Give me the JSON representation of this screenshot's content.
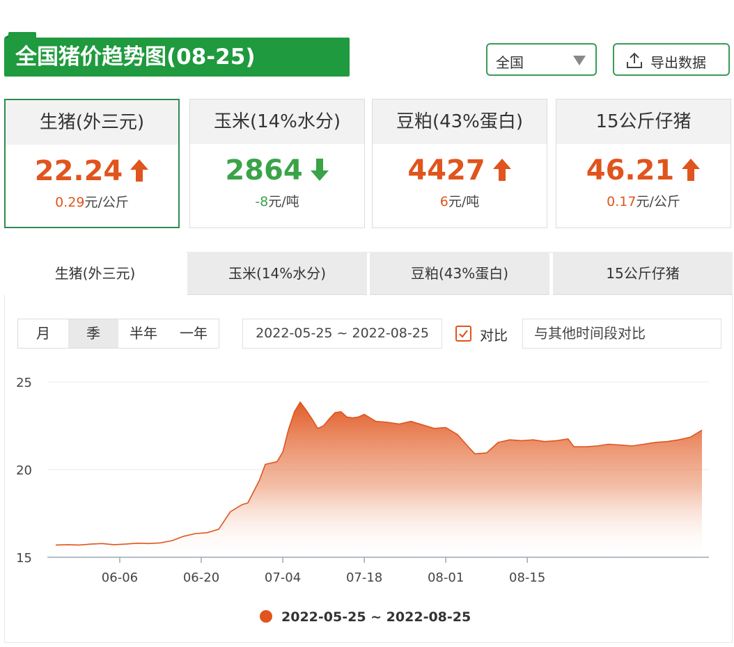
{
  "header": {
    "title": "全国猪价趋势图(08-25)",
    "region_select": "全国",
    "export_label": "导出数据"
  },
  "cards": [
    {
      "name": "生猪(外三元)",
      "value": "22.24",
      "direction": "up",
      "change": "0.29",
      "unit": "元/公斤"
    },
    {
      "name": "玉米(14%水分)",
      "value": "2864",
      "direction": "down",
      "change": "-8",
      "unit": "元/吨"
    },
    {
      "name": "豆粕(43%蛋白)",
      "value": "4427",
      "direction": "up",
      "change": "6",
      "unit": "元/吨"
    },
    {
      "name": "15公斤仔猪",
      "value": "46.21",
      "direction": "up",
      "change": "0.17",
      "unit": "元/公斤"
    }
  ],
  "tabs": [
    "生猪(外三元)",
    "玉米(14%水分)",
    "豆粕(43%蛋白)",
    "15公斤仔猪"
  ],
  "controls": {
    "periods": [
      "月",
      "季",
      "半年",
      "一年"
    ],
    "date_range": "2022-05-25 ~ 2022-08-25",
    "compare_label": "对比",
    "compare_placeholder": "与其他时间段对比"
  },
  "colors": {
    "brand_green": "#1f9a3e",
    "up": "#e0541d",
    "down": "#3aa348",
    "series": "#e0541d"
  },
  "chart_data": {
    "type": "area",
    "title": "",
    "xlabel": "",
    "ylabel": "",
    "ylim": [
      15,
      25
    ],
    "yticks": [
      15,
      20,
      25
    ],
    "x_start": "2022-05-26",
    "x_end": "2022-08-25",
    "xticks": [
      "06-06",
      "06-20",
      "07-04",
      "07-18",
      "08-01",
      "08-15"
    ],
    "legend": {
      "position": "bottom",
      "label": "2022-05-25 ~ 2022-08-25"
    },
    "grid": true,
    "series": [
      {
        "name": "2022-05-25 ~ 2022-08-25",
        "points": [
          [
            "2022-05-26",
            15.7
          ],
          [
            "2022-05-28",
            15.72
          ],
          [
            "2022-05-30",
            15.7
          ],
          [
            "2022-06-01",
            15.75
          ],
          [
            "2022-06-03",
            15.78
          ],
          [
            "2022-06-05",
            15.72
          ],
          [
            "2022-06-07",
            15.75
          ],
          [
            "2022-06-09",
            15.8
          ],
          [
            "2022-06-11",
            15.78
          ],
          [
            "2022-06-13",
            15.82
          ],
          [
            "2022-06-15",
            15.95
          ],
          [
            "2022-06-17",
            16.2
          ],
          [
            "2022-06-19",
            16.35
          ],
          [
            "2022-06-21",
            16.4
          ],
          [
            "2022-06-23",
            16.6
          ],
          [
            "2022-06-25",
            17.6
          ],
          [
            "2022-06-27",
            18.0
          ],
          [
            "2022-06-28",
            18.1
          ],
          [
            "2022-06-30",
            19.4
          ],
          [
            "2022-07-01",
            20.3
          ],
          [
            "2022-07-03",
            20.45
          ],
          [
            "2022-07-04",
            21.0
          ],
          [
            "2022-07-05",
            22.3
          ],
          [
            "2022-07-06",
            23.3
          ],
          [
            "2022-07-07",
            23.85
          ],
          [
            "2022-07-08",
            23.4
          ],
          [
            "2022-07-09",
            22.9
          ],
          [
            "2022-07-10",
            22.35
          ],
          [
            "2022-07-11",
            22.5
          ],
          [
            "2022-07-12",
            22.9
          ],
          [
            "2022-07-13",
            23.25
          ],
          [
            "2022-07-14",
            23.3
          ],
          [
            "2022-07-15",
            23.0
          ],
          [
            "2022-07-16",
            22.95
          ],
          [
            "2022-07-17",
            23.0
          ],
          [
            "2022-07-18",
            23.15
          ],
          [
            "2022-07-19",
            22.95
          ],
          [
            "2022-07-20",
            22.75
          ],
          [
            "2022-07-22",
            22.7
          ],
          [
            "2022-07-24",
            22.6
          ],
          [
            "2022-07-26",
            22.75
          ],
          [
            "2022-07-28",
            22.55
          ],
          [
            "2022-07-30",
            22.35
          ],
          [
            "2022-08-01",
            22.4
          ],
          [
            "2022-08-03",
            22.0
          ],
          [
            "2022-08-05",
            21.25
          ],
          [
            "2022-08-06",
            20.9
          ],
          [
            "2022-08-08",
            20.95
          ],
          [
            "2022-08-10",
            21.55
          ],
          [
            "2022-08-12",
            21.7
          ],
          [
            "2022-08-14",
            21.65
          ],
          [
            "2022-08-16",
            21.7
          ],
          [
            "2022-08-18",
            21.6
          ],
          [
            "2022-08-20",
            21.65
          ],
          [
            "2022-08-22",
            21.75
          ],
          [
            "2022-08-23",
            21.3
          ],
          [
            "2022-08-25",
            21.3
          ],
          [
            "2022-08-27",
            21.35
          ],
          [
            "2022-08-29",
            21.45
          ],
          [
            "2022-08-31",
            21.4
          ],
          [
            "2022-09-02",
            21.35
          ],
          [
            "2022-09-04",
            21.45
          ],
          [
            "2022-09-06",
            21.55
          ],
          [
            "2022-09-08",
            21.6
          ],
          [
            "2022-09-10",
            21.7
          ],
          [
            "2022-09-12",
            21.85
          ],
          [
            "2022-09-14",
            22.25
          ]
        ]
      }
    ]
  }
}
